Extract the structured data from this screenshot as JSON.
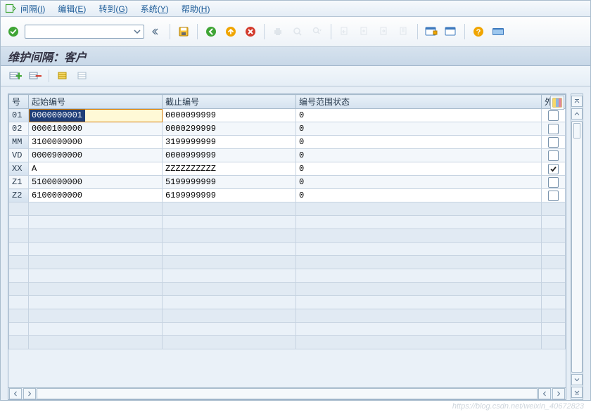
{
  "menu": {
    "items": [
      {
        "label": "间隔",
        "key": "I"
      },
      {
        "label": "编辑",
        "key": "E"
      },
      {
        "label": "转到",
        "key": "G"
      },
      {
        "label": "系统",
        "key": "Y"
      },
      {
        "label": "帮助",
        "key": "H"
      }
    ]
  },
  "page_title": "维护间隔：客户",
  "table": {
    "headers": {
      "id": "号",
      "from": "起始编号",
      "to": "截止编号",
      "status": "编号范围状态",
      "ext": "外.."
    },
    "rows": [
      {
        "id": "01",
        "from": "0000000001",
        "to": "0000099999",
        "status": "0",
        "ext": false,
        "selected": true
      },
      {
        "id": "02",
        "from": "0000100000",
        "to": "0000299999",
        "status": "0",
        "ext": false
      },
      {
        "id": "MM",
        "from": "3100000000",
        "to": "3199999999",
        "status": "0",
        "ext": false
      },
      {
        "id": "VD",
        "from": "0000900000",
        "to": "0000999999",
        "status": "0",
        "ext": false
      },
      {
        "id": "XX",
        "from": "A",
        "to": "ZZZZZZZZZZ",
        "status": "0",
        "ext": true
      },
      {
        "id": "Z1",
        "from": "5100000000",
        "to": "5199999999",
        "status": "0",
        "ext": false
      },
      {
        "id": "Z2",
        "from": "6100000000",
        "to": "6199999999",
        "status": "0",
        "ext": false
      }
    ],
    "empty_rows": 11
  },
  "colors": {
    "green": "#3fa535",
    "yellow": "#f0a500",
    "red": "#d33c2e",
    "blue": "#3b78bd",
    "grey": "#b8c3cf"
  },
  "watermark": "https://blog.csdn.net/weixin_40672823"
}
